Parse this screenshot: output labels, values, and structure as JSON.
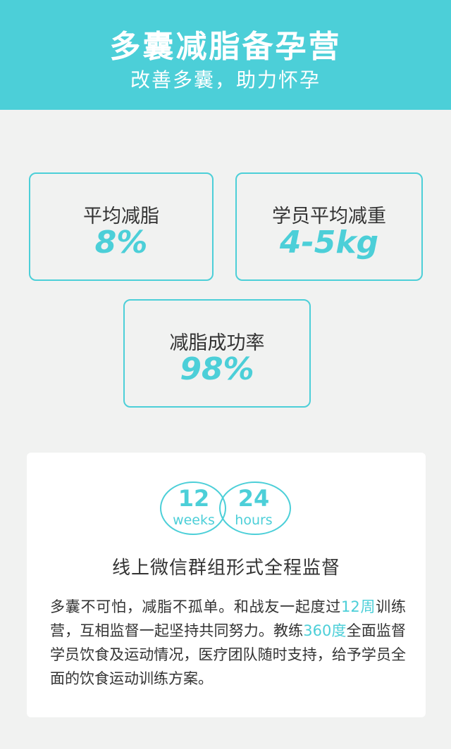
{
  "header": {
    "title": "多囊减脂备孕营",
    "subtitle": "改善多囊，助力怀孕"
  },
  "stats": [
    {
      "label": "平均减脂",
      "value": "8%"
    },
    {
      "label": "学员平均减重",
      "value": "4-5kg"
    },
    {
      "label": "减脂成功率",
      "value": "98%"
    }
  ],
  "panel": {
    "badges": [
      {
        "number": "12",
        "unit": "weeks"
      },
      {
        "number": "24",
        "unit": "hours"
      }
    ],
    "heading": "线上微信群组形式全程监督",
    "body": {
      "part1": "多囊不可怕，减脂不孤单。和战友一起度过",
      "highlight1": "12周",
      "part2": "训练营，互相监督一起坚持共同努力。教练",
      "highlight2": "360度",
      "part3": "全面监督学员饮食及运动情况，医疗团队随时支持，给予学员全面的饮食运动训练方案。"
    }
  },
  "colors": {
    "accent": "#4ccfd8",
    "background": "#f1f2f1",
    "text": "#333333"
  }
}
